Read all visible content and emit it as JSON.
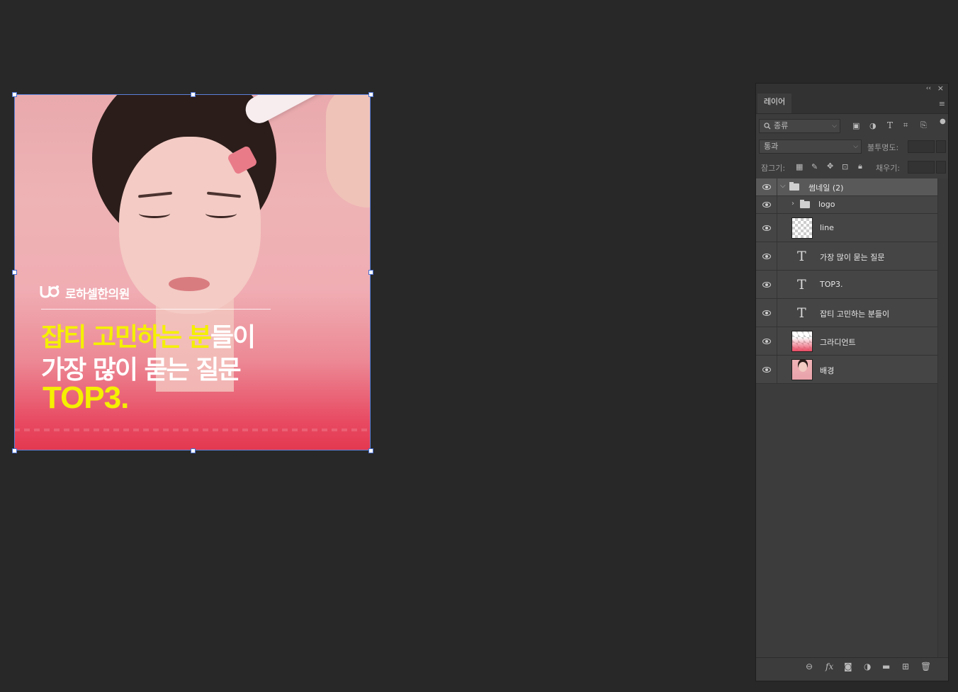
{
  "canvas": {
    "clinic_name": "로하셀한의원",
    "headline_1_yellow": "잡티 고민하는 분",
    "headline_1_white": "들이",
    "headline_2": "가장 많이 묻는 질문",
    "headline_3": "TOP3."
  },
  "panel": {
    "collapse_icon": "‹‹",
    "close_icon": "×",
    "tab_label": "레이어",
    "menu_icon": "≡",
    "filter_placeholder": "종류",
    "blend_mode": "통과",
    "opacity_label": "불투명도:",
    "lock_label": "잠그기:",
    "fill_label": "채우기:"
  },
  "layers": [
    {
      "name": "썸네일 (2)",
      "kind": "group",
      "expanded": true,
      "visible": true
    },
    {
      "name": "logo",
      "kind": "group",
      "expanded": false,
      "visible": true
    },
    {
      "name": "line",
      "kind": "pixel",
      "visible": true
    },
    {
      "name": "가장 많이 묻는 질문",
      "kind": "text",
      "visible": true
    },
    {
      "name": "TOP3.",
      "kind": "text",
      "visible": true
    },
    {
      "name": "잡티 고민하는 분들이",
      "kind": "text",
      "visible": true
    },
    {
      "name": "그라디언트",
      "kind": "gradient",
      "visible": true
    },
    {
      "name": "배경",
      "kind": "image",
      "visible": true
    }
  ],
  "colors": {
    "workspace_bg": "#282828",
    "panel_bg": "#3c3c3c",
    "headline_yellow": "#f5f000",
    "gradient_bottom": "#e3384f",
    "selection_frame": "#5b7fd8"
  }
}
